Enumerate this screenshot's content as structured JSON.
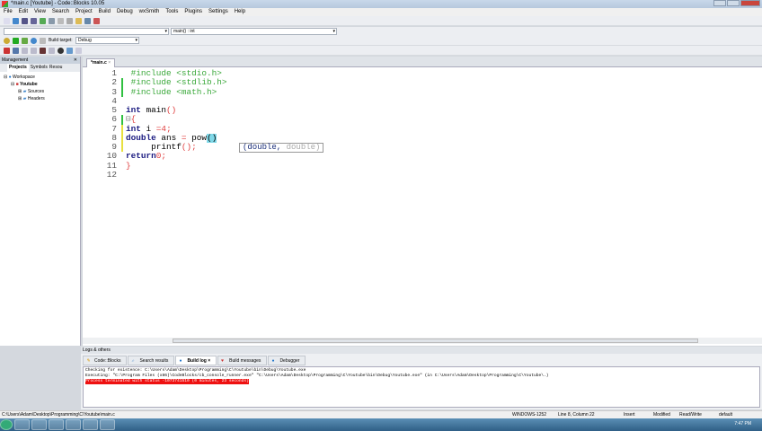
{
  "window": {
    "title": "*main.c [Youtube] - Code::Blocks 10.05"
  },
  "menu": [
    "File",
    "Edit",
    "View",
    "Search",
    "Project",
    "Build",
    "Debug",
    "wxSmith",
    "Tools",
    "Plugins",
    "Settings",
    "Help"
  ],
  "toolbar": {
    "scope_combo": "",
    "function_combo": "main() : int",
    "build_target_label": "Build target:",
    "build_target": "Debug"
  },
  "management": {
    "title": "Management",
    "tabs": [
      "Projects",
      "Symbols",
      "Resou"
    ],
    "tree": {
      "workspace": "Workspace",
      "project": "Youtube",
      "folders": [
        "Sources",
        "Headers"
      ]
    }
  },
  "editor": {
    "tab": "*main.c",
    "calltip": {
      "arg1": "(double,",
      "arg2": " double)"
    }
  },
  "logs": {
    "title": "Logs & others",
    "tabs": [
      "Code::Blocks",
      "Search results",
      "Build log",
      "Build messages",
      "Debugger"
    ],
    "active_tab": "Build log",
    "lines": [
      "Checking for existence: C:\\Users\\Adam\\Desktop\\Programming\\C\\Youtube\\bin\\Debug\\Youtube.exe",
      "Executing: \"C:\\Program Files (x86)\\CodeBlocks/cb_console_runner.exe\" \"C:\\Users\\Adam\\Desktop\\Programming\\C\\Youtube\\bin\\Debug\\Youtube.exe\"  (in C:\\Users\\Adam\\Desktop\\Programming\\C\\Youtube\\.)"
    ],
    "error": "Process terminated with status -1073741510 (0 minutes, 23 seconds)"
  },
  "status": {
    "path": "C:\\Users\\Adam\\Desktop\\Programming\\C\\Youtube\\main.c",
    "encoding": "WINDOWS-1252",
    "position": "Line 8, Column 22",
    "mode": "Insert",
    "modified": "Modified",
    "access": "Read/Write",
    "profile": "default"
  },
  "taskbar": {
    "clock": "7:47 PM"
  }
}
